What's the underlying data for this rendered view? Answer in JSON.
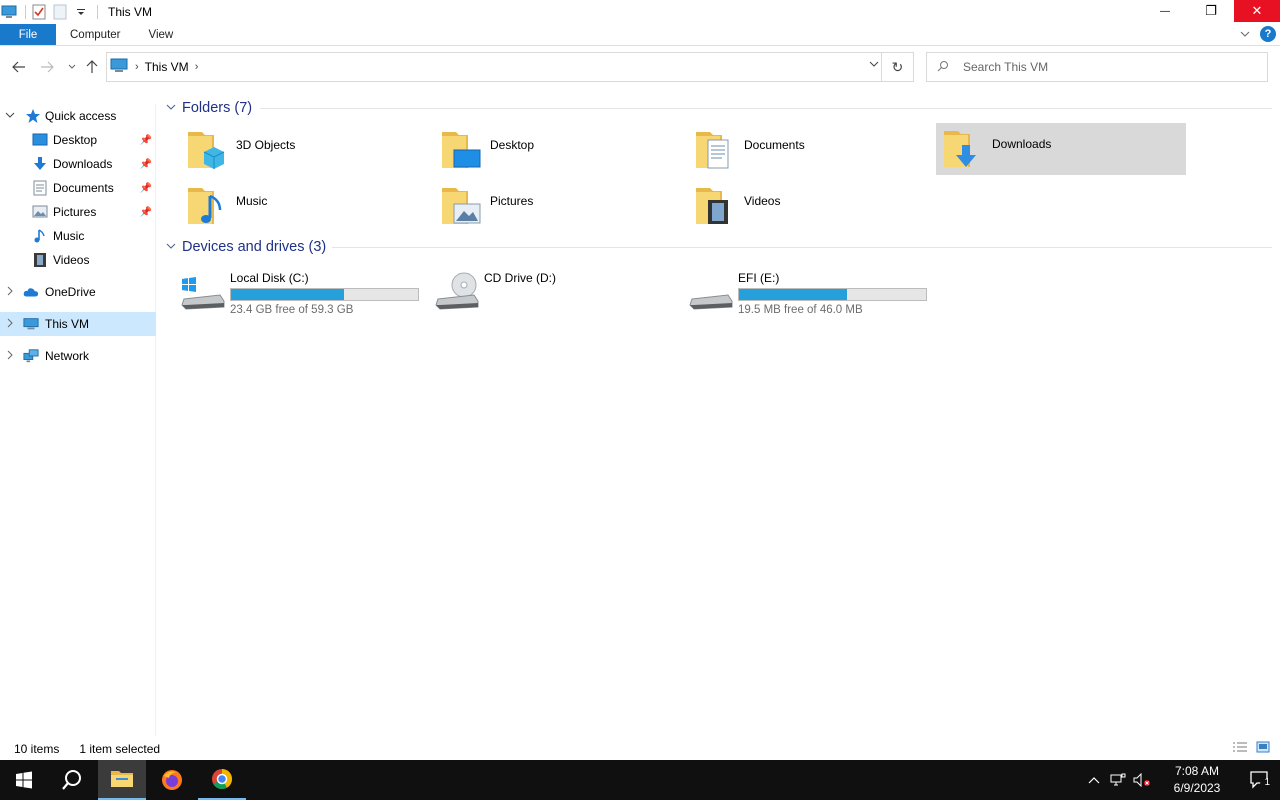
{
  "window": {
    "title": "This VM",
    "minimize": "—",
    "restore": "❐",
    "close": "✕"
  },
  "ribbon": {
    "tabs": [
      "File",
      "Computer",
      "View"
    ]
  },
  "address": {
    "path": "This VM",
    "refresh": "↻"
  },
  "search": {
    "placeholder": "Search This VM"
  },
  "sidebar": {
    "quick_access": "Quick access",
    "items": [
      {
        "label": "Desktop",
        "pinned": true
      },
      {
        "label": "Downloads",
        "pinned": true
      },
      {
        "label": "Documents",
        "pinned": true
      },
      {
        "label": "Pictures",
        "pinned": true
      },
      {
        "label": "Music",
        "pinned": false
      },
      {
        "label": "Videos",
        "pinned": false
      }
    ],
    "onedrive": "OneDrive",
    "this_vm": "This VM",
    "network": "Network"
  },
  "folders": {
    "header": "Folders (7)",
    "items": [
      {
        "name": "3D Objects"
      },
      {
        "name": "Desktop"
      },
      {
        "name": "Documents"
      },
      {
        "name": "Downloads",
        "selected": true
      },
      {
        "name": "Music"
      },
      {
        "name": "Pictures"
      },
      {
        "name": "Videos"
      }
    ]
  },
  "drives": {
    "header": "Devices and drives (3)",
    "items": [
      {
        "name": "Local Disk (C:)",
        "free": "23.4 GB free of 59.3 GB",
        "used_fraction": 0.605
      },
      {
        "name": "CD Drive (D:)"
      },
      {
        "name": "EFI (E:)",
        "free": "19.5 MB free of 46.0 MB",
        "used_fraction": 0.576
      }
    ]
  },
  "status": {
    "count": "10 items",
    "selection": "1 item selected"
  },
  "taskbar": {
    "time": "7:08 AM",
    "date": "6/9/2023",
    "notification_count": "1"
  },
  "colors": {
    "accent": "#1979ca",
    "selection": "#cce8ff",
    "tile_selected": "#d9d9d9",
    "drive_bar": "#26a0da",
    "close_red": "#e81123",
    "group_header": "#1e3287"
  }
}
